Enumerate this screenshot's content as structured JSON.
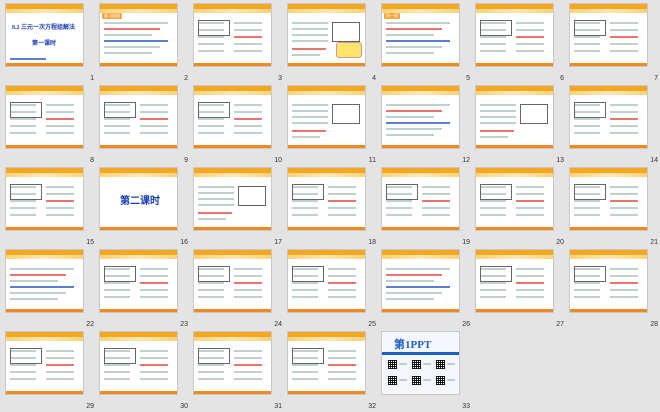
{
  "view": {
    "mode": "slide-sorter",
    "slide_count": 33
  },
  "colors": {
    "accent": "#f5a623",
    "title_blue": "#1a3fb5",
    "highlight_red": "#e0473c"
  },
  "slides": [
    {
      "number": "1",
      "tag": "",
      "title": "8.2 三元一次方程组解法",
      "subtitle": "第一课时"
    },
    {
      "number": "2",
      "tag": "复习回顾",
      "title": "",
      "subtitle": ""
    },
    {
      "number": "3",
      "tag": "",
      "title": "",
      "subtitle": ""
    },
    {
      "number": "4",
      "tag": "",
      "title": "",
      "subtitle": ""
    },
    {
      "number": "5",
      "tag": "探一探",
      "title": "",
      "subtitle": ""
    },
    {
      "number": "6",
      "tag": "",
      "title": "",
      "subtitle": ""
    },
    {
      "number": "7",
      "tag": "",
      "title": "",
      "subtitle": ""
    },
    {
      "number": "8",
      "tag": "",
      "title": "",
      "subtitle": ""
    },
    {
      "number": "9",
      "tag": "",
      "title": "",
      "subtitle": ""
    },
    {
      "number": "10",
      "tag": "",
      "title": "",
      "subtitle": ""
    },
    {
      "number": "11",
      "tag": "",
      "title": "",
      "subtitle": ""
    },
    {
      "number": "12",
      "tag": "",
      "title": "",
      "subtitle": ""
    },
    {
      "number": "13",
      "tag": "",
      "title": "",
      "subtitle": ""
    },
    {
      "number": "14",
      "tag": "",
      "title": "",
      "subtitle": ""
    },
    {
      "number": "15",
      "tag": "",
      "title": "",
      "subtitle": ""
    },
    {
      "number": "16",
      "tag": "",
      "title": "第二课时",
      "subtitle": ""
    },
    {
      "number": "17",
      "tag": "",
      "title": "",
      "subtitle": ""
    },
    {
      "number": "18",
      "tag": "",
      "title": "",
      "subtitle": ""
    },
    {
      "number": "19",
      "tag": "",
      "title": "",
      "subtitle": ""
    },
    {
      "number": "20",
      "tag": "",
      "title": "",
      "subtitle": ""
    },
    {
      "number": "21",
      "tag": "",
      "title": "",
      "subtitle": ""
    },
    {
      "number": "22",
      "tag": "",
      "title": "",
      "subtitle": ""
    },
    {
      "number": "23",
      "tag": "",
      "title": "",
      "subtitle": ""
    },
    {
      "number": "24",
      "tag": "",
      "title": "",
      "subtitle": ""
    },
    {
      "number": "25",
      "tag": "",
      "title": "",
      "subtitle": ""
    },
    {
      "number": "26",
      "tag": "",
      "title": "",
      "subtitle": ""
    },
    {
      "number": "27",
      "tag": "",
      "title": "",
      "subtitle": ""
    },
    {
      "number": "28",
      "tag": "",
      "title": "",
      "subtitle": ""
    },
    {
      "number": "29",
      "tag": "",
      "title": "",
      "subtitle": ""
    },
    {
      "number": "30",
      "tag": "",
      "title": "",
      "subtitle": ""
    },
    {
      "number": "31",
      "tag": "",
      "title": "",
      "subtitle": ""
    },
    {
      "number": "32",
      "tag": "",
      "title": "",
      "subtitle": ""
    },
    {
      "number": "33",
      "tag": "",
      "title": "第1PPT",
      "subtitle": ""
    }
  ]
}
